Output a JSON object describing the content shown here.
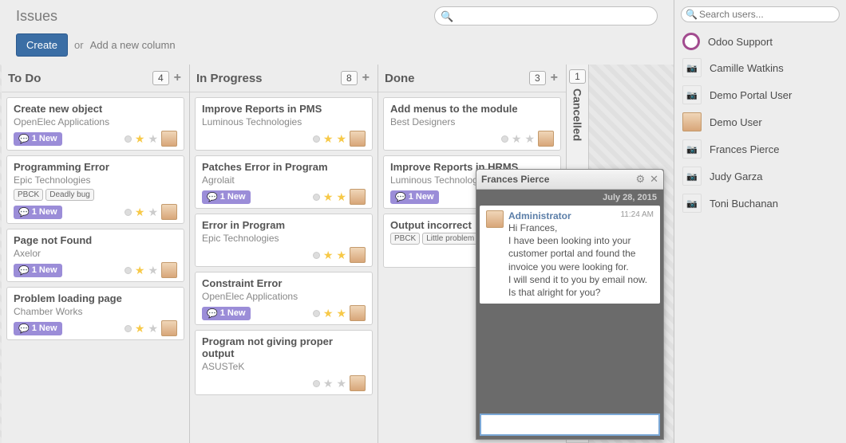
{
  "header": {
    "title": "Issues",
    "search_placeholder": ""
  },
  "actions": {
    "create": "Create",
    "or": "or",
    "newcol": "Add a new column"
  },
  "columns": [
    {
      "name": "To Do",
      "count": "4",
      "cards": [
        {
          "title": "Create new object",
          "sub": "OpenElec Applications",
          "tags": [],
          "new": "1 New",
          "stars": 1
        },
        {
          "title": "Programming Error",
          "sub": "Epic Technologies",
          "tags": [
            "PBCK",
            "Deadly bug"
          ],
          "new": "1 New",
          "stars": 1
        },
        {
          "title": "Page not Found",
          "sub": "Axelor",
          "tags": [],
          "new": "1 New",
          "stars": 1
        },
        {
          "title": "Problem loading page",
          "sub": "Chamber Works",
          "tags": [],
          "new": "1 New",
          "stars": 1
        }
      ]
    },
    {
      "name": "In Progress",
      "count": "8",
      "cards": [
        {
          "title": "Improve Reports in PMS",
          "sub": "Luminous Technologies",
          "tags": [],
          "new": "",
          "stars": 2
        },
        {
          "title": "Patches Error in Program",
          "sub": "Agrolait",
          "tags": [],
          "new": "1 New",
          "stars": 2
        },
        {
          "title": "Error in Program",
          "sub": "Epic Technologies",
          "tags": [],
          "new": "",
          "stars": 2
        },
        {
          "title": "Constraint Error",
          "sub": "OpenElec Applications",
          "tags": [],
          "new": "1 New",
          "stars": 2
        },
        {
          "title": "Program not giving proper output",
          "sub": "ASUSTeK",
          "tags": [],
          "new": "",
          "stars": 0
        }
      ]
    },
    {
      "name": "Done",
      "count": "3",
      "cards": [
        {
          "title": "Add menus to the module",
          "sub": "Best Designers",
          "tags": [],
          "new": "",
          "stars": 0
        },
        {
          "title": "Improve Reports in HRMS",
          "sub": "Luminous Technologies",
          "tags": [],
          "new": "1 New",
          "stars": 0
        },
        {
          "title": "Output incorrect",
          "sub": "",
          "tags": [
            "PBCK",
            "Little problem"
          ],
          "new": "",
          "stars": 0
        }
      ]
    },
    {
      "name": "Cancelled",
      "count": "1",
      "collapsed": true
    }
  ],
  "users_search_placeholder": "Search users...",
  "users": [
    {
      "name": "Odoo Support",
      "kind": "odoo"
    },
    {
      "name": "Camille Watkins",
      "kind": "cam"
    },
    {
      "name": "Demo Portal User",
      "kind": "cam"
    },
    {
      "name": "Demo User",
      "kind": "face"
    },
    {
      "name": "Frances Pierce",
      "kind": "cam"
    },
    {
      "name": "Judy Garza",
      "kind": "cam"
    },
    {
      "name": "Toni Buchanan",
      "kind": "cam"
    }
  ],
  "chat": {
    "with": "Frances Pierce",
    "date": "July 28, 2015",
    "msg": {
      "from": "Administrator",
      "time": "11:24 AM",
      "body": "Hi Frances,\nI have been looking into your customer portal and found the invoice you were looking for.\nI will send it to you by email now.\nIs that alright for you?"
    }
  }
}
